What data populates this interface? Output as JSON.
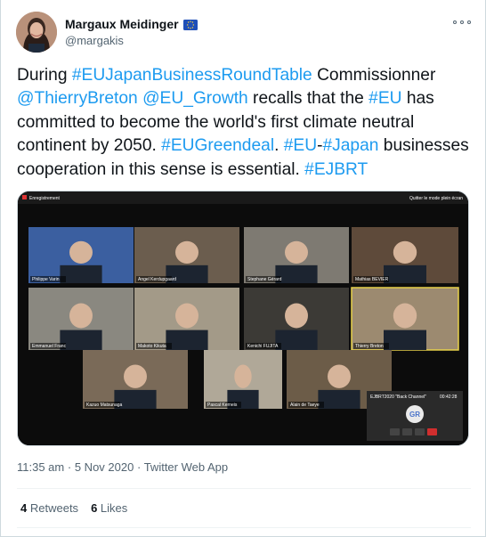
{
  "author": {
    "display_name": "Margaux Meidinger",
    "handle": "@margakis",
    "flag_icon": "eu-flag-icon"
  },
  "tweet": {
    "segments": [
      {
        "text": "During ",
        "link": false
      },
      {
        "text": "#EUJapanBusinessRoundTable",
        "link": true
      },
      {
        "text": " Commissionner ",
        "link": false
      },
      {
        "text": "@ThierryBreton",
        "link": true
      },
      {
        "text": " ",
        "link": false
      },
      {
        "text": "@EU_Growth",
        "link": true
      },
      {
        "text": " recalls that the ",
        "link": false
      },
      {
        "text": "#EU",
        "link": true
      },
      {
        "text": " has committed to become the world's first climate neutral continent by 2050. ",
        "link": false
      },
      {
        "text": "#EUGreendeal",
        "link": true
      },
      {
        "text": ". ",
        "link": false
      },
      {
        "text": "#EU",
        "link": true
      },
      {
        "text": "-",
        "link": false
      },
      {
        "text": "#Japan",
        "link": true
      },
      {
        "text": " businesses cooperation in this sense is essential. ",
        "link": false
      },
      {
        "text": "#EJBRT",
        "link": true
      }
    ]
  },
  "media": {
    "recording_label": "Enregistrement",
    "fullscreen_label": "Quitter le mode plein écran",
    "participants": [
      "Philippe Varin",
      "Angel Kerdupgaard",
      "Stephane Gérard",
      "Mathias BEVIER",
      "Emmanuel Franc",
      "Makoto Kikuta",
      "Kenichi FUJITA",
      "Thierry Breton",
      "Kazuo Matsunaga",
      "Pascal Kerneis",
      "Alain de Taeye"
    ],
    "call_title": "EJBRT2020 \"Back Channel\"",
    "call_time": "00:42:28",
    "call_initials": "GR"
  },
  "meta": {
    "time": "11:35 am",
    "separator": "·",
    "date": "5 Nov 2020",
    "source": "Twitter Web App"
  },
  "stats": {
    "retweets_count": "4",
    "retweets_label": "Retweets",
    "likes_count": "6",
    "likes_label": "Likes"
  },
  "colors": {
    "link": "#1d9bf0",
    "text": "#0f1419",
    "secondary": "#536471"
  }
}
